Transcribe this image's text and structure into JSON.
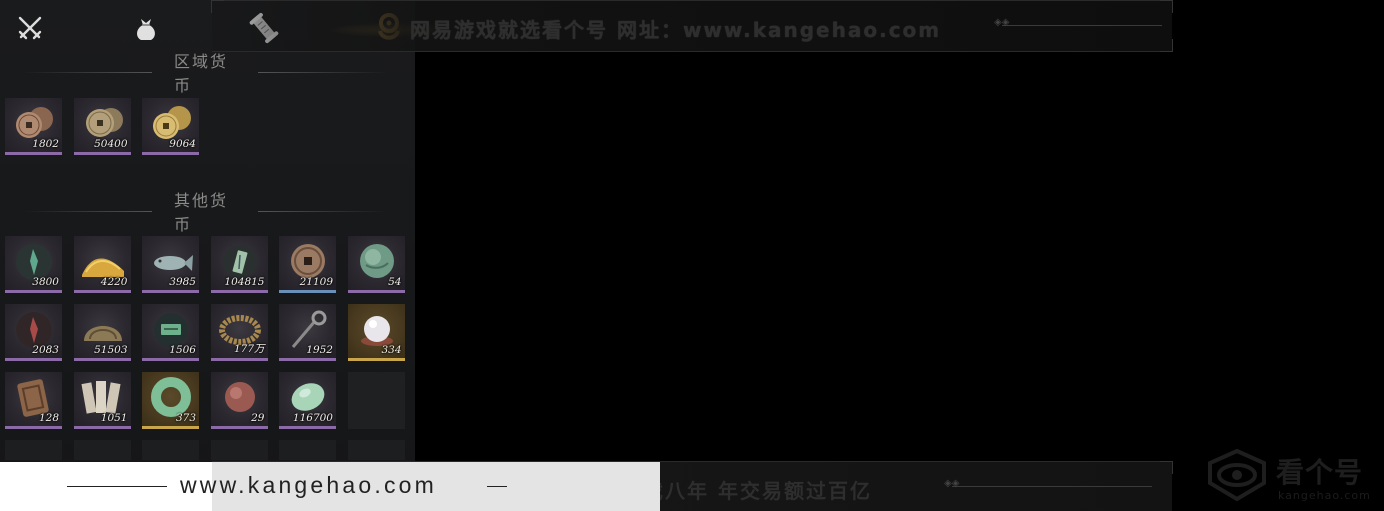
{
  "tabs": [
    {
      "icon": "crossed-swords-icon"
    },
    {
      "icon": "pouch-icon"
    },
    {
      "icon": "scroll-icon"
    },
    {
      "icon": "coin-icon",
      "active": true
    }
  ],
  "sections": {
    "regional": {
      "title": "区域货币",
      "items": [
        {
          "icon": "copper-coins-icon",
          "count": "1802"
        },
        {
          "icon": "bronze-coins-icon",
          "count": "50400"
        },
        {
          "icon": "gold-coins-icon",
          "count": "9064"
        }
      ]
    },
    "other": {
      "title": "其他货币",
      "items": [
        {
          "icon": "jade-leaf-icon",
          "count": "3800"
        },
        {
          "icon": "grain-pile-icon",
          "count": "4220"
        },
        {
          "icon": "fish-icon",
          "count": "3985"
        },
        {
          "icon": "jade-tablet-icon",
          "count": "104815"
        },
        {
          "icon": "ancient-coin-icon",
          "count": "21109",
          "rarity": "blue"
        },
        {
          "icon": "jade-orb-icon",
          "count": "54"
        },
        {
          "icon": "red-leaf-icon",
          "count": "2083"
        },
        {
          "icon": "shell-coin-icon",
          "count": "51503"
        },
        {
          "icon": "jade-ticket-icon",
          "count": "1506"
        },
        {
          "icon": "coin-string-icon",
          "count": "177万"
        },
        {
          "icon": "spade-coin-icon",
          "count": "1952"
        },
        {
          "icon": "pearl-icon",
          "count": "334",
          "rarity": "gold"
        },
        {
          "icon": "bronze-plaque-icon",
          "count": "128"
        },
        {
          "icon": "paper-notes-icon",
          "count": "1051"
        },
        {
          "icon": "jade-ring-icon",
          "count": "373",
          "rarity": "gold"
        },
        {
          "icon": "red-stone-icon",
          "count": "29"
        },
        {
          "icon": "jade-pebble-icon",
          "count": "116700"
        }
      ]
    }
  },
  "watermark": {
    "top_text": "网易游戏就选看个号   网址：www.kangehao.com",
    "bottom_text": "看个号专业网易游戏八年   年交易额过百亿",
    "url": "www.kangehao.com",
    "logo_name": "看个号",
    "logo_sub": "kangehao.com"
  },
  "colors": {
    "rarity_purple": "#8c6aa8",
    "rarity_gold": "#c9a54c",
    "rarity_blue": "#6a8fb8",
    "accent_gold": "#c89a3a"
  }
}
